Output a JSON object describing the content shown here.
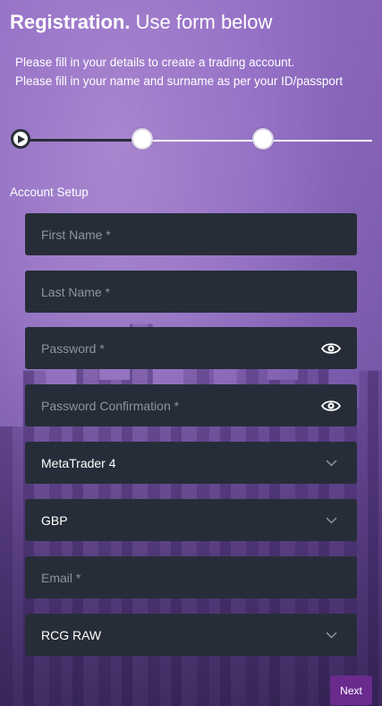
{
  "header": {
    "title_bold": "Registration.",
    "title_rest": "Use form below",
    "subtitle_line1": "Please fill in your details to create a trading account.",
    "subtitle_line2": "Please fill in your name and surname as per your ID/passport"
  },
  "stepper": {
    "current_step": 1,
    "total_steps": 3
  },
  "section": {
    "label": "Account Setup"
  },
  "form": {
    "first_name": {
      "placeholder": "First Name  *",
      "value": ""
    },
    "last_name": {
      "placeholder": "Last Name  *",
      "value": ""
    },
    "password": {
      "placeholder": "Password  *",
      "value": "",
      "icon": "eye-icon"
    },
    "password_confirmation": {
      "placeholder": "Password Confirmation  *",
      "value": "",
      "icon": "eye-icon"
    },
    "platform": {
      "selected": "MetaTrader 4",
      "icon": "chevron-down-icon"
    },
    "currency": {
      "selected": "GBP",
      "icon": "chevron-down-icon"
    },
    "email": {
      "placeholder": "Email  *",
      "value": ""
    },
    "account_type": {
      "selected": "RCG RAW",
      "icon": "chevron-down-icon"
    }
  },
  "actions": {
    "next_label": "Next"
  },
  "colors": {
    "field_bg": "#262d38",
    "placeholder": "#8d93a0",
    "button_bg": "#6a2a8e",
    "stepper_active": "#2a2f3a"
  }
}
